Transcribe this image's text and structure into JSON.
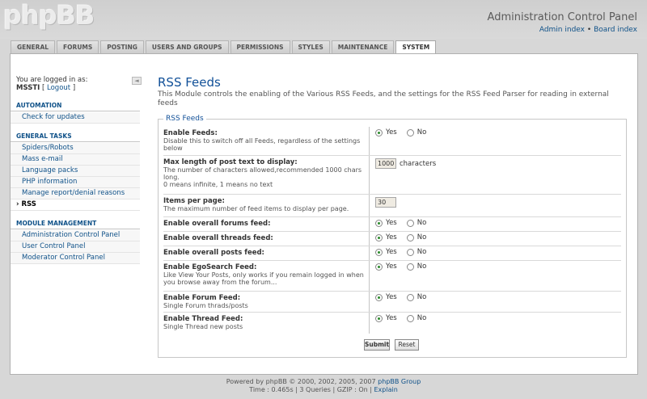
{
  "header": {
    "logo": "phpBB",
    "title": "Administration Control Panel",
    "admin_index": "Admin index",
    "separator": "•",
    "board_index": "Board index"
  },
  "tabs": [
    {
      "label": "GENERAL"
    },
    {
      "label": "FORUMS"
    },
    {
      "label": "POSTING"
    },
    {
      "label": "USERS AND GROUPS"
    },
    {
      "label": "PERMISSIONS"
    },
    {
      "label": "STYLES"
    },
    {
      "label": "MAINTENANCE"
    },
    {
      "label": "SYSTEM"
    }
  ],
  "sidebar": {
    "logged_in_as": "You are logged in as:",
    "username": "MSSTI",
    "logout": "Logout",
    "collapse_icon": "◄",
    "sections": [
      {
        "header": "AUTOMATION",
        "items": [
          "Check for updates"
        ]
      },
      {
        "header": "GENERAL TASKS",
        "items": [
          "Spiders/Robots",
          "Mass e-mail",
          "Language packs",
          "PHP information",
          "Manage report/denial reasons",
          "RSS"
        ]
      },
      {
        "header": "MODULE MANAGEMENT",
        "items": [
          "Administration Control Panel",
          "User Control Panel",
          "Moderator Control Panel"
        ]
      }
    ]
  },
  "main": {
    "title": "RSS Feeds",
    "description": "This Module controls the enabling of the Various RSS Feeds, and the settings for the RSS Feed Parser for reading in external feeds",
    "legend": "RSS Feeds",
    "yes": "Yes",
    "no": "No",
    "rows": [
      {
        "title": "Enable Feeds:",
        "desc": "Disable this to switch off all Feeds, regardless of the settings below"
      },
      {
        "title": "Max length of post text to display:",
        "desc": "The number of characters allowed,recommended 1000 chars long.",
        "desc2": "0 means infinite, 1 means no text",
        "value": "1000",
        "suffix": "characters"
      },
      {
        "title": "Items per page:",
        "desc": "The maximum number of feed items to display per page.",
        "value": "30"
      },
      {
        "title": "Enable overall forums feed:"
      },
      {
        "title": "Enable overall threads feed:"
      },
      {
        "title": "Enable overall posts feed:"
      },
      {
        "title": "Enable EgoSearch Feed:",
        "desc": "Like View Your Posts, only works if you remain logged in when you browse away from the forum..."
      },
      {
        "title": "Enable Forum Feed:",
        "desc": "Single Forum thrads/posts"
      },
      {
        "title": "Enable Thread Feed:",
        "desc": "Single Thread new posts"
      }
    ],
    "submit": "Submit",
    "reset": "Reset"
  },
  "footer": {
    "line1_prefix": "Powered by phpBB © 2000, 2002, 2005, 2007",
    "line1_link": "phpBB Group",
    "line2_prefix": "Time : 0.465s | 3 Queries | GZIP : On |",
    "line2_link": "Explain"
  }
}
